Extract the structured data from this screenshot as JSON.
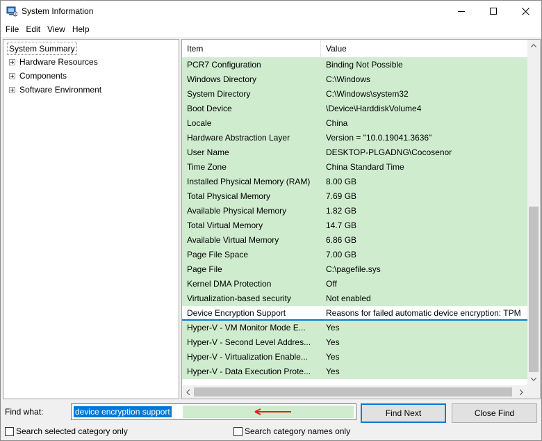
{
  "window": {
    "title": "System Information",
    "icon": "system-information-icon",
    "controls": {
      "minimize": "minimize-icon",
      "maximize": "maximize-icon",
      "close": "close-icon"
    }
  },
  "menu": [
    "File",
    "Edit",
    "View",
    "Help"
  ],
  "tree": {
    "root": "System Summary",
    "children": [
      "Hardware Resources",
      "Components",
      "Software Environment"
    ]
  },
  "list": {
    "headers": {
      "item": "Item",
      "value": "Value"
    },
    "rows": [
      {
        "item": "PCR7 Configuration",
        "value": "Binding Not Possible"
      },
      {
        "item": "Windows Directory",
        "value": "C:\\Windows"
      },
      {
        "item": "System Directory",
        "value": "C:\\Windows\\system32"
      },
      {
        "item": "Boot Device",
        "value": "\\Device\\HarddiskVolume4"
      },
      {
        "item": "Locale",
        "value": "China"
      },
      {
        "item": "Hardware Abstraction Layer",
        "value": "Version = \"10.0.19041.3636\""
      },
      {
        "item": "User Name",
        "value": "DESKTOP-PLGADNG\\Cocosenor"
      },
      {
        "item": "Time Zone",
        "value": "China Standard Time"
      },
      {
        "item": "Installed Physical Memory (RAM)",
        "value": "8.00 GB"
      },
      {
        "item": "Total Physical Memory",
        "value": "7.69 GB"
      },
      {
        "item": "Available Physical Memory",
        "value": "1.82 GB"
      },
      {
        "item": "Total Virtual Memory",
        "value": "14.7 GB"
      },
      {
        "item": "Available Virtual Memory",
        "value": "6.86 GB"
      },
      {
        "item": "Page File Space",
        "value": "7.00 GB"
      },
      {
        "item": "Page File",
        "value": "C:\\pagefile.sys"
      },
      {
        "item": "Kernel DMA Protection",
        "value": "Off"
      },
      {
        "item": "Virtualization-based security",
        "value": "Not enabled"
      },
      {
        "item": "Device Encryption Support",
        "value": "Reasons for failed automatic device encryption: TPM",
        "selected": true
      },
      {
        "item": "Hyper-V - VM Monitor Mode E...",
        "value": "Yes"
      },
      {
        "item": "Hyper-V - Second Level Addres...",
        "value": "Yes"
      },
      {
        "item": "Hyper-V - Virtualization Enable...",
        "value": "Yes"
      },
      {
        "item": "Hyper-V - Data Execution Prote...",
        "value": "Yes"
      }
    ]
  },
  "find": {
    "label": "Find what:",
    "value": "device encryption support",
    "find_next": "Find Next",
    "close_find": "Close Find",
    "search_selected": "Search selected category only",
    "search_names": "Search category names only"
  },
  "colors": {
    "row_highlight": "#cfeccf",
    "selection_accent": "#0a79d6",
    "annotation_arrow": "#e02020"
  }
}
